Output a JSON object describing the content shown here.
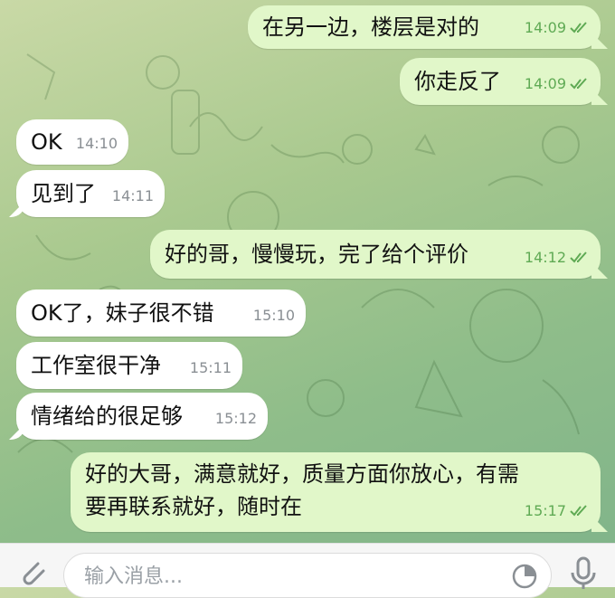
{
  "messages": [
    {
      "dir": "out",
      "text": "在另一边，楼层是对的",
      "time": "14:09"
    },
    {
      "dir": "out",
      "text": "你走反了",
      "time": "14:09"
    },
    {
      "dir": "in",
      "text": "OK",
      "time": "14:10"
    },
    {
      "dir": "in",
      "text": "见到了",
      "time": "14:11"
    },
    {
      "dir": "out",
      "text": "好的哥，慢慢玩，完了给个评价",
      "time": "14:12"
    },
    {
      "dir": "in",
      "text": "OK了，妹子很不错",
      "time": "15:10"
    },
    {
      "dir": "in",
      "text": "工作室很干净",
      "time": "15:11"
    },
    {
      "dir": "in",
      "text": "情绪给的很足够",
      "time": "15:12"
    },
    {
      "dir": "out",
      "text_line1": "好的大哥，满意就好，质量方面你放心，有需",
      "text_line2": "要再联系就好，随时在",
      "time": "15:17"
    }
  ],
  "composer": {
    "placeholder": "输入消息..."
  },
  "colors": {
    "incoming_bubble": "#ffffff",
    "outgoing_bubble": "#e1f7c9",
    "read_check": "#5faa54"
  },
  "icons": [
    "attach-icon",
    "sticker-icon",
    "microphone-icon",
    "double-check-icon"
  ]
}
